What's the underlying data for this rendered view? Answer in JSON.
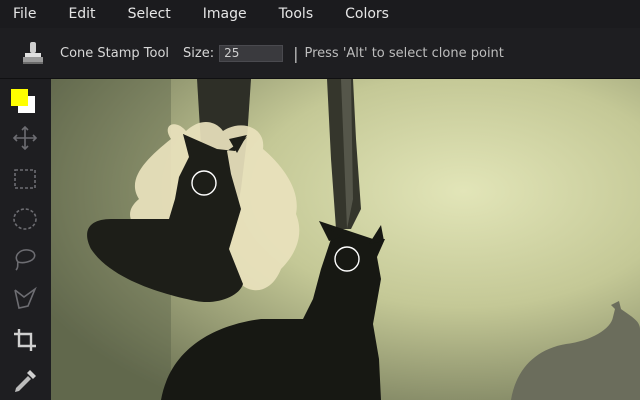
{
  "menubar": {
    "items": [
      "File",
      "Edit",
      "Select",
      "Image",
      "Tools",
      "Colors"
    ]
  },
  "options": {
    "tool_name": "Cone Stamp Tool",
    "size_label": "Size:",
    "size_value": "25",
    "separator": "|",
    "hint": "Press 'Alt' to select clone point"
  },
  "toolbox": {
    "foreground_color": "#ffff00",
    "background_color": "#ffffff",
    "tools": [
      "move-icon",
      "rect-select-icon",
      "ellipse-select-icon",
      "lasso-icon",
      "polygon-lasso-icon",
      "crop-icon",
      "eyedropper-icon"
    ]
  },
  "colors": {
    "accent_fg": "#ffff00",
    "ui_bg": "#1e1e21"
  }
}
